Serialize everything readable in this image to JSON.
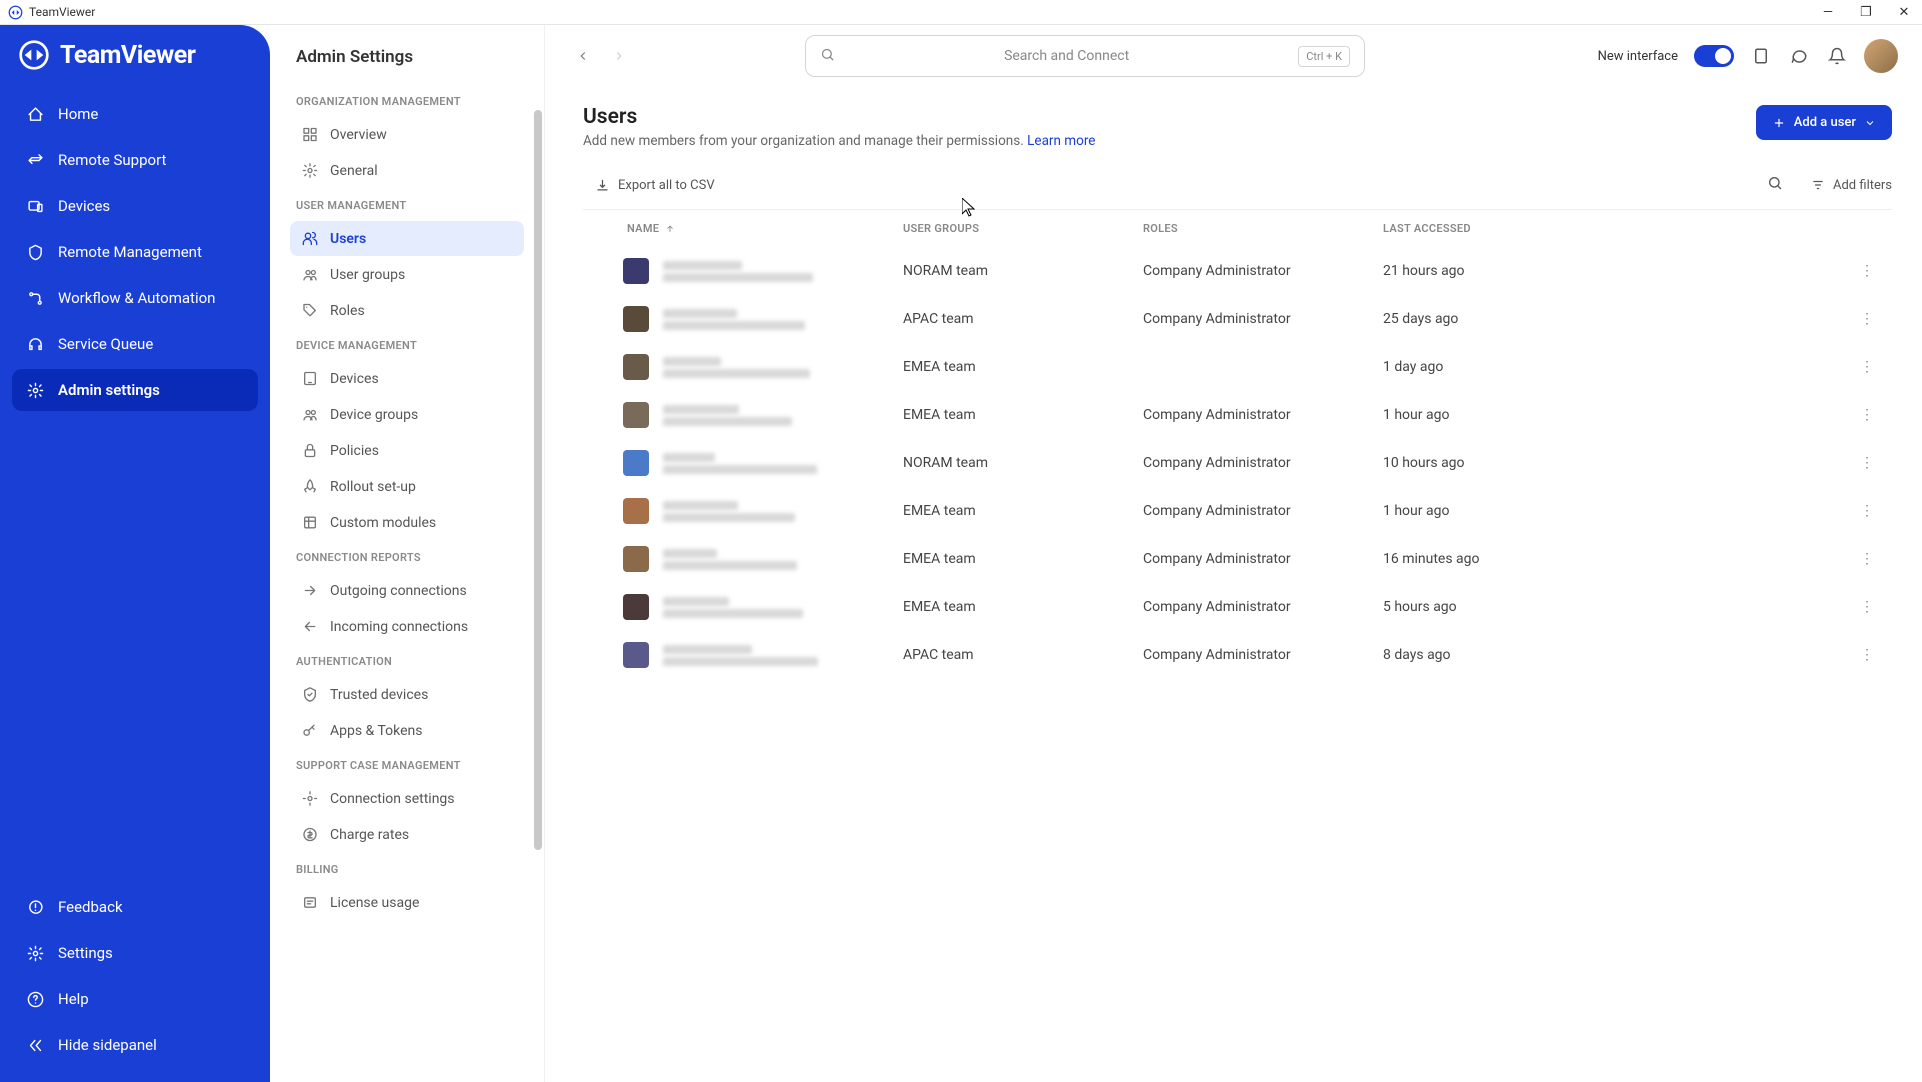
{
  "window": {
    "title": "TeamViewer"
  },
  "brand": {
    "name": "TeamViewer"
  },
  "primaryNav": {
    "items": [
      {
        "label": "Home",
        "icon": "home"
      },
      {
        "label": "Remote Support",
        "icon": "swap"
      },
      {
        "label": "Devices",
        "icon": "devices"
      },
      {
        "label": "Remote Management",
        "icon": "shield"
      },
      {
        "label": "Workflow & Automation",
        "icon": "flow"
      },
      {
        "label": "Service Queue",
        "icon": "headset"
      },
      {
        "label": "Admin settings",
        "icon": "gear",
        "active": true
      }
    ],
    "bottom": [
      {
        "label": "Feedback",
        "icon": "feedback"
      },
      {
        "label": "Settings",
        "icon": "gear"
      },
      {
        "label": "Help",
        "icon": "help"
      },
      {
        "label": "Hide sidepanel",
        "icon": "collapse"
      }
    ]
  },
  "secondaryNav": {
    "title": "Admin Settings",
    "groups": [
      {
        "label": "ORGANIZATION MANAGEMENT",
        "items": [
          {
            "label": "Overview",
            "icon": "grid"
          },
          {
            "label": "General",
            "icon": "gear"
          }
        ]
      },
      {
        "label": "USER MANAGEMENT",
        "items": [
          {
            "label": "Users",
            "icon": "users",
            "active": true
          },
          {
            "label": "User groups",
            "icon": "group"
          },
          {
            "label": "Roles",
            "icon": "tag"
          }
        ]
      },
      {
        "label": "DEVICE MANAGEMENT",
        "items": [
          {
            "label": "Devices",
            "icon": "device"
          },
          {
            "label": "Device groups",
            "icon": "group"
          },
          {
            "label": "Policies",
            "icon": "lock"
          },
          {
            "label": "Rollout set-up",
            "icon": "rocket"
          },
          {
            "label": "Custom modules",
            "icon": "module"
          }
        ]
      },
      {
        "label": "CONNECTION REPORTS",
        "items": [
          {
            "label": "Outgoing connections",
            "icon": "out"
          },
          {
            "label": "Incoming connections",
            "icon": "in"
          }
        ]
      },
      {
        "label": "AUTHENTICATION",
        "items": [
          {
            "label": "Trusted devices",
            "icon": "trusted"
          },
          {
            "label": "Apps & Tokens",
            "icon": "key"
          }
        ]
      },
      {
        "label": "SUPPORT CASE MANAGEMENT",
        "items": [
          {
            "label": "Connection settings",
            "icon": "settings"
          },
          {
            "label": "Charge rates",
            "icon": "money"
          }
        ]
      },
      {
        "label": "BILLING",
        "items": [
          {
            "label": "License usage",
            "icon": "license"
          }
        ]
      }
    ]
  },
  "search": {
    "placeholder": "Search and Connect",
    "shortcut": "Ctrl + K"
  },
  "topbar": {
    "newInterface": "New interface"
  },
  "page": {
    "title": "Users",
    "subtitle": "Add new members from your organization and manage their permissions.",
    "learnMore": "Learn more",
    "addUserBtn": "Add a user",
    "exportBtn": "Export all to CSV",
    "addFiltersBtn": "Add filters"
  },
  "table": {
    "columns": {
      "name": "NAME",
      "groups": "USER GROUPS",
      "roles": "ROLES",
      "lastAccessed": "LAST ACCESSED"
    },
    "rows": [
      {
        "avatarColor": "#3a3a6e",
        "group": "NORAM team",
        "role": "Company Administrator",
        "last": "21 hours ago"
      },
      {
        "avatarColor": "#5a4a3a",
        "group": "APAC team",
        "role": "Company Administrator",
        "last": "25 days ago"
      },
      {
        "avatarColor": "#6a5a4a",
        "group": "EMEA team",
        "role": "",
        "last": "1 day ago"
      },
      {
        "avatarColor": "#7a6a5a",
        "group": "EMEA team",
        "role": "Company Administrator",
        "last": "1 hour ago"
      },
      {
        "avatarColor": "#4a7ac8",
        "group": "NORAM team",
        "role": "Company Administrator",
        "last": "10 hours ago"
      },
      {
        "avatarColor": "#a87048",
        "group": "EMEA team",
        "role": "Company Administrator",
        "last": "1 hour ago"
      },
      {
        "avatarColor": "#8a6a4a",
        "group": "EMEA team",
        "role": "Company Administrator",
        "last": "16 minutes ago"
      },
      {
        "avatarColor": "#4a3a3a",
        "group": "EMEA team",
        "role": "Company Administrator",
        "last": "5 hours ago"
      },
      {
        "avatarColor": "#5a5a8a",
        "group": "APAC team",
        "role": "Company Administrator",
        "last": "8 days ago"
      }
    ]
  }
}
